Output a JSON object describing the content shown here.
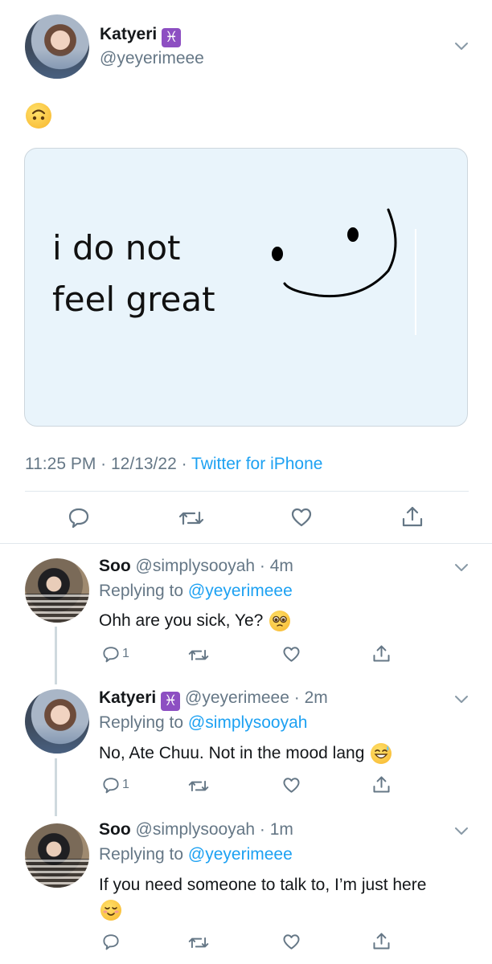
{
  "main_tweet": {
    "author_name": "Katyeri",
    "author_badge": "♓",
    "author_handle": "@yeyerimeee",
    "text_emoji": "upside-down-face-emoji",
    "image_text": "i do not\nfeel great",
    "time": "11:25 PM",
    "date": "12/13/22",
    "source": "Twitter for iPhone",
    "separator": " · "
  },
  "replies": [
    {
      "name": "Soo",
      "handle": "@simplysooyah",
      "age": "4m",
      "replying_label": "Replying to",
      "replying_to": "@yeyerimeee",
      "text": "Ohh are you sick, Ye?",
      "emoji": "pleading-face-emoji",
      "reply_count": "1"
    },
    {
      "name": "Katyeri",
      "badge": "♓",
      "handle": "@yeyerimeee",
      "age": "2m",
      "replying_label": "Replying to",
      "replying_to": "@simplysooyah",
      "text": "No, Ate Chuu. Not in the mood lang",
      "emoji": "grinning-sweat-emoji",
      "reply_count": "1"
    },
    {
      "name": "Soo",
      "handle": "@simplysooyah",
      "age": "1m",
      "replying_label": "Replying to",
      "replying_to": "@yeyerimeee",
      "text": "If you need someone to talk to, I’m just here",
      "emoji": "smiling-face-emoji",
      "reply_count": ""
    }
  ],
  "colors": {
    "link": "#1da1f2",
    "secondary": "#657786",
    "divider": "#e1e8ed",
    "badge": "#8d4fc2",
    "image_bg": "#e9f4fb"
  }
}
